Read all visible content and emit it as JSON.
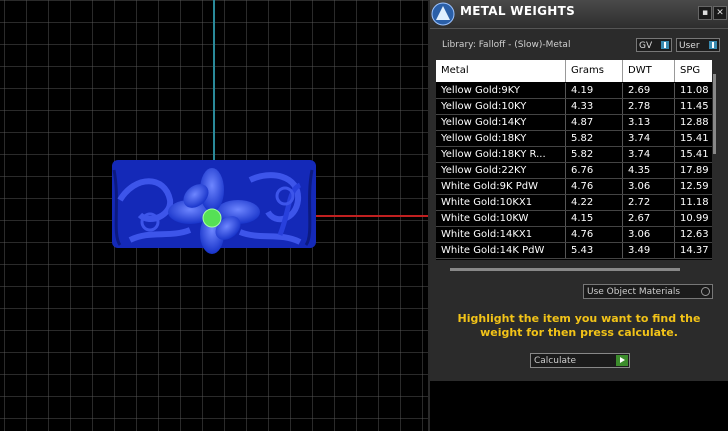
{
  "panel": {
    "title": "METAL WEIGHTS",
    "library_label": "Library: Falloff - (Slow)-Metal",
    "gv_label": "GV",
    "user_label": "User",
    "columns": [
      "Metal",
      "Grams",
      "DWT",
      "SPG"
    ],
    "rows": [
      [
        "Yellow Gold:9KY",
        "4.19",
        "2.69",
        "11.08"
      ],
      [
        "Yellow Gold:10KY",
        "4.33",
        "2.78",
        "11.45"
      ],
      [
        "Yellow Gold:14KY",
        "4.87",
        "3.13",
        "12.88"
      ],
      [
        "Yellow Gold:18KY",
        "5.82",
        "3.74",
        "15.41"
      ],
      [
        "Yellow Gold:18KY R...",
        "5.82",
        "3.74",
        "15.41"
      ],
      [
        "Yellow Gold:22KY",
        "6.76",
        "4.35",
        "17.89"
      ],
      [
        "White Gold:9K PdW",
        "4.76",
        "3.06",
        "12.59"
      ],
      [
        "White Gold:10KX1",
        "4.22",
        "2.72",
        "11.18"
      ],
      [
        "White Gold:10KW",
        "4.15",
        "2.67",
        "10.99"
      ],
      [
        "White Gold:14KX1",
        "4.76",
        "3.06",
        "12.63"
      ],
      [
        "White Gold:14K PdW",
        "5.43",
        "3.49",
        "14.37"
      ]
    ],
    "use_object_materials": "Use Object Materials",
    "instructions": "Highlight the item you want to find the weight for then press calculate.",
    "calculate_label": "Calculate"
  },
  "colors": {
    "object": "#1a33c8",
    "axis_y": "#2a8a9a",
    "axis_x": "#c02020",
    "pivot": "#55e055",
    "instructions": "#f2c318"
  },
  "icons": [
    "metal-weights-icon",
    "minimize-icon",
    "close-icon",
    "calculate-arrow-icon"
  ]
}
